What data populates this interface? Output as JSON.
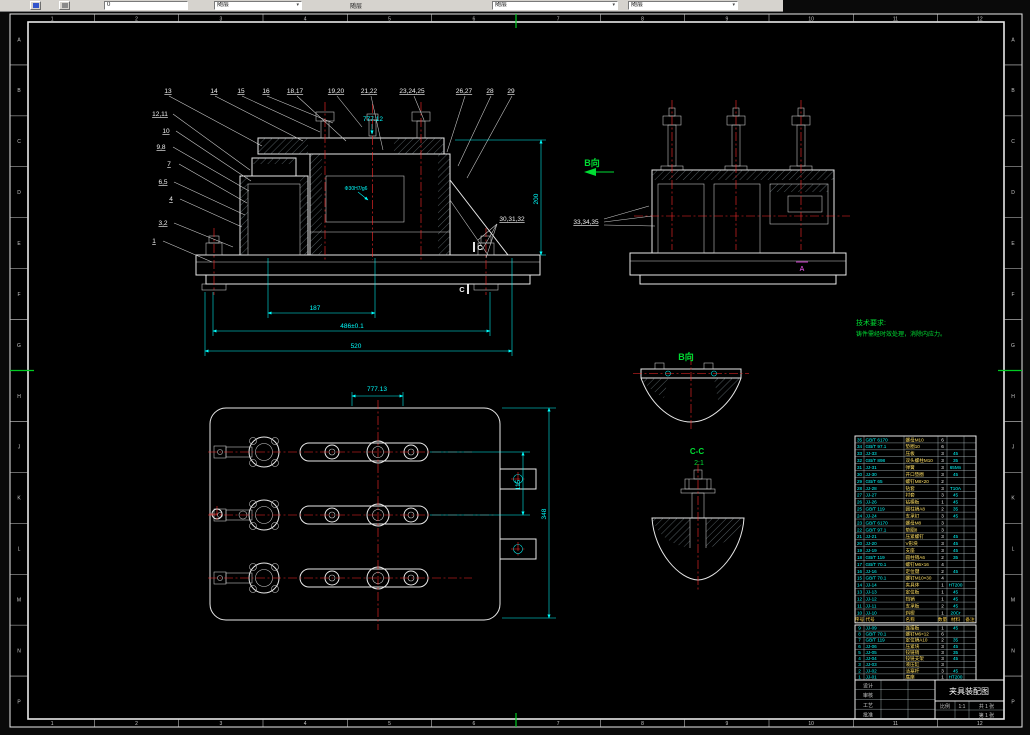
{
  "toolbar": {
    "field": "0",
    "combo1": "随层",
    "label": "随层",
    "combo2": "随层",
    "combo3": "随层"
  },
  "sheet": {
    "cols": [
      "1",
      "2",
      "3",
      "4",
      "5",
      "6",
      "7",
      "8",
      "9",
      "10",
      "11",
      "12"
    ],
    "rows": [
      "A",
      "B",
      "C",
      "D",
      "E",
      "F",
      "G",
      "H",
      "J",
      "K",
      "L",
      "M",
      "N",
      "P"
    ]
  },
  "front_view": {
    "callouts_top": [
      "13",
      "14",
      "15",
      "16",
      "18,17",
      "19,20",
      "21,22",
      "23,24,25",
      "26,27",
      "28",
      "29"
    ],
    "callouts_left": [
      "12,11",
      "10",
      "9,8",
      "7",
      "6,5",
      "4",
      "3,2",
      "1"
    ],
    "callout_right": "30,31,32",
    "dim_top": "777.12",
    "dim_fit": "Φ30H7/g6",
    "dim_right": "200",
    "dim_a": "187",
    "dim_b": "486±0.1",
    "dim_c": "520",
    "section_mark": "C"
  },
  "side_view": {
    "view_label": "B向",
    "callouts": "33,34,35",
    "datum": "A"
  },
  "notes": {
    "title": "技术要求:",
    "line1": "铸件需经时效处理，消除内应力。"
  },
  "aux_view": {
    "label": "B向"
  },
  "section_view": {
    "label": "C-C",
    "scale": "2:1"
  },
  "plan_view": {
    "dim_top": "777.13",
    "dim_right1": "115",
    "dim_right2": "348"
  },
  "bom": {
    "headers": [
      "序号",
      "代号",
      "名称",
      "数量",
      "材料",
      "备注"
    ],
    "upper_rows": [
      [
        "35",
        "GB/T 6170",
        "螺母M10",
        "6",
        "",
        ""
      ],
      [
        "34",
        "GB/T 97.1",
        "垫圈10",
        "6",
        "",
        ""
      ],
      [
        "33",
        "JJ-33",
        "压板",
        "3",
        "45",
        ""
      ],
      [
        "32",
        "GB/T 898",
        "双头螺柱M10",
        "3",
        "35",
        ""
      ],
      [
        "31",
        "JJ-31",
        "弹簧",
        "3",
        "65Mn",
        ""
      ],
      [
        "30",
        "JJ-30",
        "开口垫圈",
        "3",
        "45",
        ""
      ],
      [
        "29",
        "GB/T 65",
        "螺钉M8×20",
        "2",
        "",
        ""
      ],
      [
        "28",
        "JJ-28",
        "钻套",
        "3",
        "T10A",
        ""
      ],
      [
        "27",
        "JJ-27",
        "衬套",
        "3",
        "45",
        ""
      ],
      [
        "26",
        "JJ-26",
        "钻模板",
        "1",
        "45",
        ""
      ],
      [
        "25",
        "GB/T 119",
        "圆柱销A8",
        "2",
        "35",
        ""
      ],
      [
        "24",
        "JJ-24",
        "支承钉",
        "3",
        "45",
        ""
      ],
      [
        "23",
        "GB/T 6170",
        "螺母M8",
        "3",
        "",
        ""
      ],
      [
        "22",
        "GB/T 97.1",
        "垫圈8",
        "3",
        "",
        ""
      ],
      [
        "21",
        "JJ-21",
        "压紧螺钉",
        "3",
        "45",
        ""
      ],
      [
        "20",
        "JJ-20",
        "V形块",
        "3",
        "45",
        ""
      ],
      [
        "19",
        "JJ-19",
        "支座",
        "3",
        "45",
        ""
      ],
      [
        "18",
        "GB/T 119",
        "圆柱销A6",
        "2",
        "35",
        ""
      ],
      [
        "17",
        "GB/T 70.1",
        "螺钉M6×16",
        "4",
        "",
        ""
      ],
      [
        "16",
        "JJ-16",
        "定位键",
        "2",
        "45",
        ""
      ],
      [
        "15",
        "GB/T 70.1",
        "螺钉M10×30",
        "4",
        "",
        ""
      ],
      [
        "14",
        "JJ-14",
        "夹具体",
        "1",
        "HT200",
        ""
      ],
      [
        "13",
        "JJ-13",
        "定位板",
        "1",
        "45",
        ""
      ],
      [
        "12",
        "JJ-12",
        "挡销",
        "1",
        "45",
        ""
      ],
      [
        "11",
        "JJ-11",
        "支承板",
        "2",
        "45",
        ""
      ],
      [
        "10",
        "JJ-10",
        "斜楔",
        "1",
        "20Cr",
        ""
      ]
    ],
    "lower_rows": [
      [
        "9",
        "JJ-09",
        "连接板",
        "1",
        "45",
        ""
      ],
      [
        "8",
        "GB/T 70.1",
        "螺钉M6×12",
        "6",
        "",
        ""
      ],
      [
        "7",
        "GB/T 119",
        "定位销A10",
        "2",
        "35",
        ""
      ],
      [
        "6",
        "JJ-06",
        "压紧块",
        "3",
        "45",
        ""
      ],
      [
        "5",
        "JJ-05",
        "铰链销",
        "3",
        "35",
        ""
      ],
      [
        "4",
        "JJ-04",
        "铰链支架",
        "3",
        "45",
        ""
      ],
      [
        "3",
        "JJ-03",
        "液压缸",
        "3",
        "",
        ""
      ],
      [
        "2",
        "JJ-02",
        "活塞杆",
        "3",
        "45",
        ""
      ],
      [
        "1",
        "JJ-01",
        "底座",
        "1",
        "HT200",
        ""
      ]
    ]
  },
  "title_block": {
    "sign_labels": [
      "设计",
      "审核",
      "工艺",
      "批准"
    ],
    "title": "夹具装配图",
    "scale_label": "比例",
    "scale": "1:1",
    "sheets": "共 1 张",
    "sheet_no": "第 1 张"
  }
}
